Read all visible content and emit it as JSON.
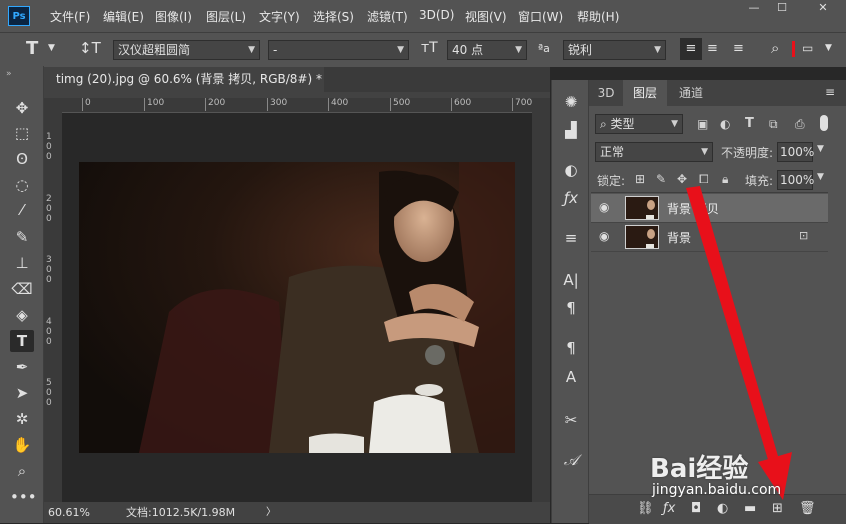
{
  "menu": {
    "logo": "Ps",
    "items": [
      "文件(F)",
      "编辑(E)",
      "图像(I)",
      "图层(L)",
      "文字(Y)",
      "选择(S)",
      "滤镜(T)",
      "3D(D)",
      "视图(V)",
      "窗口(W)",
      "帮助(H)"
    ]
  },
  "options": {
    "font_family": "汉仪超粗圆简",
    "font_style": "-",
    "font_size": "40 点",
    "antialias_icon": "ªa",
    "antialias": "锐利"
  },
  "document": {
    "tab_title": "timg (20).jpg @ 60.6% (背景 拷贝, RGB/8#) *",
    "ruler_ticks": [
      "0",
      "100",
      "200",
      "300",
      "400",
      "500",
      "600",
      "700"
    ],
    "vruler_ticks": [
      "1",
      "0",
      "0",
      "2",
      "0",
      "0",
      "3",
      "0",
      "0",
      "4",
      "0",
      "0",
      "5",
      "0",
      "0"
    ],
    "zoom": "60.61%",
    "doc_info": "文档:1012.5K/1.98M"
  },
  "layers_panel": {
    "tabs": [
      "3D",
      "图层",
      "通道"
    ],
    "active_tab": "图层",
    "filter_kind": "类型",
    "blend_mode": "正常",
    "opacity_label": "不透明度:",
    "opacity_value": "100%",
    "lock_label": "锁定:",
    "fill_label": "填充:",
    "fill_value": "100%",
    "layers": [
      {
        "name": "背景 拷贝",
        "selected": true,
        "locked": false
      },
      {
        "name": "背景",
        "selected": false,
        "locked": true
      }
    ]
  },
  "watermark": {
    "brand": "Bai经验",
    "url": "jingyan.baidu.com"
  },
  "colors": {
    "accent": "#31a8ff",
    "arrow": "#e8101a"
  }
}
